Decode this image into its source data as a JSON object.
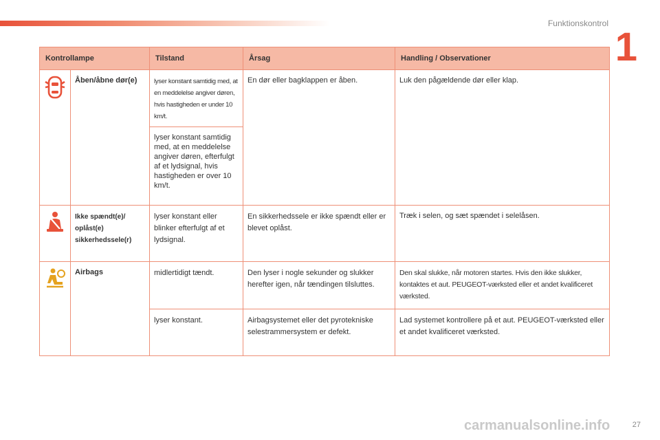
{
  "header": {
    "section_title": "Funktionskontrol",
    "chapter_number": "1"
  },
  "table": {
    "columns": [
      "Kontrollampe",
      "Tilstand",
      "Årsag",
      "Handling / Observationer"
    ],
    "rows": [
      {
        "icon": "door-open-icon",
        "name": "Åben/åbne dør(e)",
        "states": [
          {
            "condition": "lyser konstant samtidig med, at en meddelelse angiver døren, hvis hastigheden er under 10 km/t.",
            "cause": "En dør eller bagklappen er åben.",
            "action": "Luk den pågældende dør eller klap."
          },
          {
            "condition": "lyser konstant samtidig med, at en meddelelse angiver døren, efterfulgt af et lydsignal, hvis hastigheden er over 10 km/t."
          }
        ]
      },
      {
        "icon": "seatbelt-icon",
        "name": "Ikke spændt(e)/ oplåst(e) sikkerhedssele(r)",
        "states": [
          {
            "condition": "lyser konstant eller blinker efterfulgt af et lydsignal.",
            "cause": "En sikkerhedssele er ikke spændt eller er blevet oplåst.",
            "action": "Træk i selen, og sæt spændet i selelåsen."
          }
        ]
      },
      {
        "icon": "airbag-icon",
        "name": "Airbags",
        "states": [
          {
            "condition": "midlertidigt tændt.",
            "cause": "Den lyser i nogle sekunder og slukker herefter igen, når tændingen tilsluttes.",
            "action": "Den skal slukke, når motoren startes. Hvis den ikke slukker, kontaktes et aut. PEUGEOT-værksted eller et andet kvalificeret værksted."
          },
          {
            "condition": "lyser konstant.",
            "cause": "Airbagsystemet eller det pyrotekniske selestrammersystem er defekt.",
            "action": "Lad systemet kontrollere på et aut. PEUGEOT-værksted eller et andet kvalificeret værksted."
          }
        ]
      }
    ]
  },
  "footer": {
    "page_number": "27",
    "watermark": "carmanualsonline.info"
  },
  "colors": {
    "accent": "#e8523a",
    "header_bg": "#f6b9a5",
    "name_cell_bg": "#fde3d8",
    "border": "#ee8f76"
  }
}
